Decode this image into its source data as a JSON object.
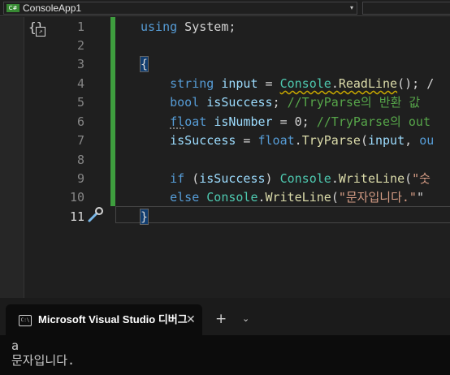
{
  "project_bar": {
    "badge": "C#",
    "project": "ConsoleApp1",
    "arrow": "▾"
  },
  "editor": {
    "snippet_icon": "quick-actions-icon",
    "line_numbers": [
      "1",
      "2",
      "3",
      "4",
      "5",
      "6",
      "7",
      "8",
      "9",
      "10",
      "11"
    ],
    "lines": [
      "using System;",
      "",
      "{",
      "    string input = Console.ReadLine(); /",
      "    bool isSuccess; //TryParse의 반환 값",
      "    float isNumber = 0; //TryParse의 out",
      "    isSuccess = float.TryParse(input, ou",
      "",
      "    if (isSuccess) Console.WriteLine(\"숫",
      "    else Console.WriteLine(\"문자입니다.\"",
      "}"
    ],
    "active_line": "11",
    "change_bar_color": "#3e9e3e"
  },
  "terminal": {
    "tab_title": "Microsoft Visual Studio 디버그",
    "tab_icon": "console-icon",
    "close": "✕",
    "new_tab": "+",
    "dropdown": "⌄",
    "output": [
      "a",
      "문자입니다."
    ]
  },
  "colors": {
    "keyword": "#569cd6",
    "type": "#4ec9b0",
    "method": "#dcdcaa",
    "identifier": "#9cdcfe",
    "comment": "#57a64a",
    "string": "#d69d85"
  }
}
